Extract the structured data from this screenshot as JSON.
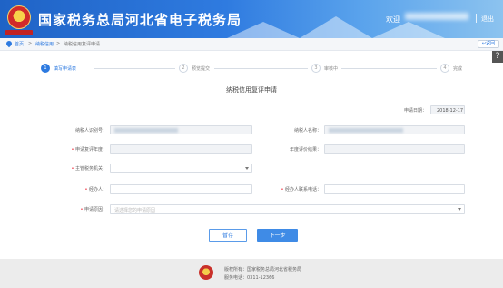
{
  "header": {
    "title": "国家税务总局河北省电子税务局",
    "welcome": "欢迎",
    "logout": "退出"
  },
  "breadcrumb": {
    "home": "首页",
    "sep1": ">",
    "item1": "纳税信用",
    "sep2": ">",
    "item2": "纳税信用复评申请",
    "back": "返回"
  },
  "help_icon": "?",
  "steps": [
    {
      "num": "1",
      "label": "填写申请表",
      "state": "active"
    },
    {
      "num": "2",
      "label": "预览提交",
      "state": "pending"
    },
    {
      "num": "3",
      "label": "审核中",
      "state": "pending"
    },
    {
      "num": "4",
      "label": "完成",
      "state": "pending"
    }
  ],
  "form": {
    "title": "纳税信用复评申请",
    "date_label": "申请日期：",
    "date_value": "2018-12-17",
    "taxpayer_id_label": "纳税人识别号：",
    "taxpayer_name_label": "纳税人名称：",
    "eval_year_label": "申请复评年度：",
    "annual_result_label": "年度评价结果：",
    "tax_authority_label": "主管税务机关：",
    "contact_label": "经办人：",
    "contact_phone_label": "经办人联系电话：",
    "reason_label": "申请原因：",
    "reason_placeholder": "请选择您的申请原因"
  },
  "buttons": {
    "save": "暂存",
    "next": "下一步"
  },
  "footer": {
    "copyright": "版权所有：国家税务总局河北省税务局",
    "hotline": "服务电话：0311-12366"
  },
  "colors": {
    "primary": "#2d7ae0",
    "header_start": "#1f63c6",
    "required": "#e23"
  }
}
